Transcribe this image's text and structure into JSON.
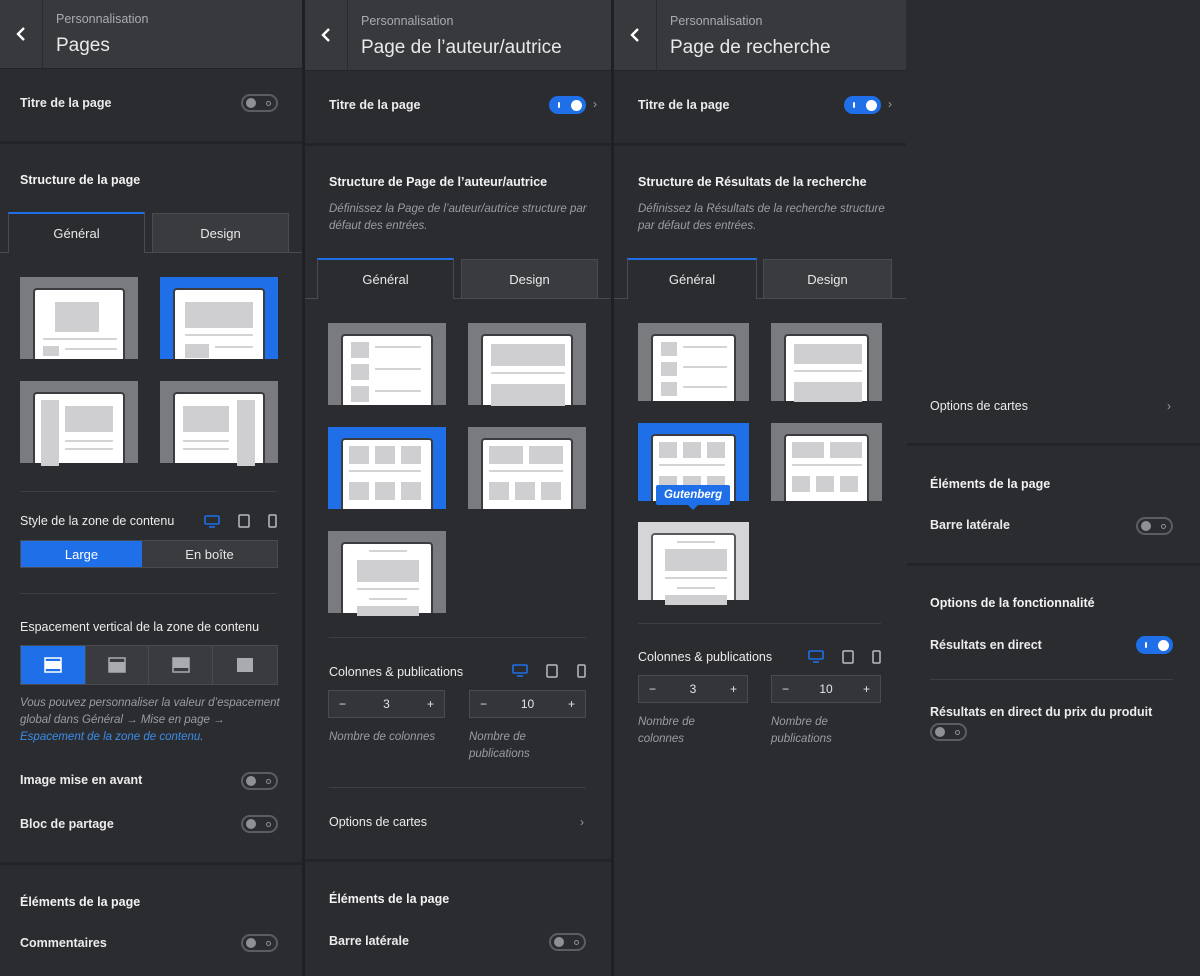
{
  "colors": {
    "accent": "#1e6fe8",
    "panel": "#2b2c2f",
    "header": "#38393d"
  },
  "panel1": {
    "header": {
      "subtitle": "Personnalisation",
      "title": "Pages"
    },
    "page_title_label": "Titre de la page",
    "structure_title": "Structure de la page",
    "tabs": [
      "Général",
      "Design"
    ],
    "content_style_label": "Style de la zone de contenu",
    "content_style_options": [
      "Large",
      "En boîte"
    ],
    "vertical_spacing_label": "Espacement vertical de la zone de contenu",
    "help_prefix": "Vous pouvez personnaliser la valeur d’espacement global dans Général → Mise en page → ",
    "help_link": "Espacement de la zone de contenu",
    "help_suffix": ".",
    "featured_image_label": "Image mise en avant",
    "share_block_label": "Bloc de partage",
    "page_elements_title": "Éléments de la page",
    "comments_label": "Commentaires"
  },
  "panel2": {
    "header": {
      "subtitle": "Personnalisation",
      "title": "Page de l’auteur/autrice"
    },
    "page_title_label": "Titre de la page",
    "structure_title": "Structure de Page de l’auteur/autrice",
    "structure_desc": "Définissez la Page de l’auteur/autrice structure par défaut des entrées.",
    "tabs": [
      "Général",
      "Design"
    ],
    "columns_label": "Colonnes & publications",
    "columns_value": "3",
    "posts_value": "10",
    "columns_caption": "Nombre de colonnes",
    "posts_caption": "Nombre de publications",
    "card_options_label": "Options de cartes",
    "page_elements_title": "Éléments de la page",
    "sidebar_label": "Barre latérale"
  },
  "panel3": {
    "header": {
      "subtitle": "Personnalisation",
      "title": "Page de recherche"
    },
    "page_title_label": "Titre de la page",
    "structure_title": "Structure de Résultats de la recherche",
    "structure_desc": "Définissez la Résultats de la recherche structure par défaut des entrées.",
    "tabs": [
      "Général",
      "Design"
    ],
    "tooltip": "Gutenberg",
    "columns_label": "Colonnes & publications",
    "columns_value": "3",
    "posts_value": "10",
    "columns_caption": "Nombre de colonnes",
    "posts_caption": "Nombre de publications"
  },
  "panel4": {
    "card_options_label": "Options de cartes",
    "page_elements_title": "Éléments de la page",
    "sidebar_label": "Barre latérale",
    "features_title": "Options de la fonctionnalité",
    "live_results_label": "Résultats en direct",
    "live_price_label": "Résultats en direct du prix du produit"
  },
  "controls": {
    "minus": "−",
    "plus": "+",
    "chevron": "›"
  }
}
